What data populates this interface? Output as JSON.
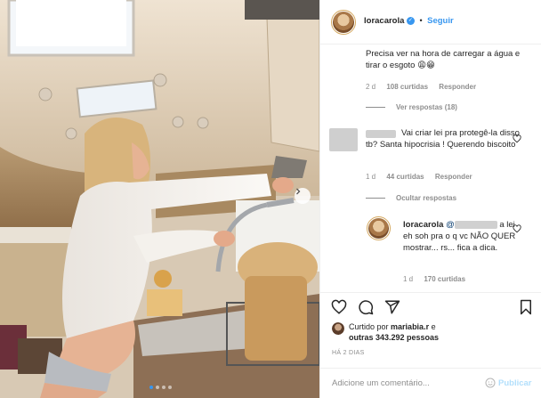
{
  "post": {
    "author": "loracarola",
    "follow_label": "Seguir",
    "separator": "•"
  },
  "comments": [
    {
      "text": "Precisa ver na hora de carregar a água e tirar o esgoto 😩😁",
      "time": "2 d",
      "likes": "108 curtidas",
      "reply_label": "Responder",
      "view_replies": "Ver respostas (18)"
    },
    {
      "text": "Vai criar lei pra protegê-la disso tb? Santa hipocrisia ! Querendo biscoito",
      "time": "1 d",
      "likes": "44 curtidas",
      "reply_label": "Responder",
      "hide_replies": "Ocultar respostas"
    },
    {
      "author": "loracarola",
      "text_start": "@",
      "text_rest": "a lei eh soh pra o q vc NÃO QUER mostrar... rs... fica a dica.",
      "time": "1 d",
      "likes": "170 curtidas"
    }
  ],
  "actions": {
    "liked_by_prefix": "Curtido por",
    "liked_by_user": "mariabia.r",
    "liked_by_and": "e",
    "liked_by_count": "outras 343.292 pessoas",
    "date": "HÁ 2 DIAS"
  },
  "add_comment": {
    "placeholder": "Adicione um comentário...",
    "publish_label": "Publicar"
  },
  "colors": {
    "accent": "#3897f0",
    "muted": "#8e8e8e"
  },
  "icons": [
    "heart-icon",
    "comment-icon",
    "share-icon",
    "bookmark-icon",
    "verified-icon",
    "emoji-icon",
    "next-arrow-icon"
  ],
  "carousel": {
    "total": 4,
    "active": 1
  }
}
